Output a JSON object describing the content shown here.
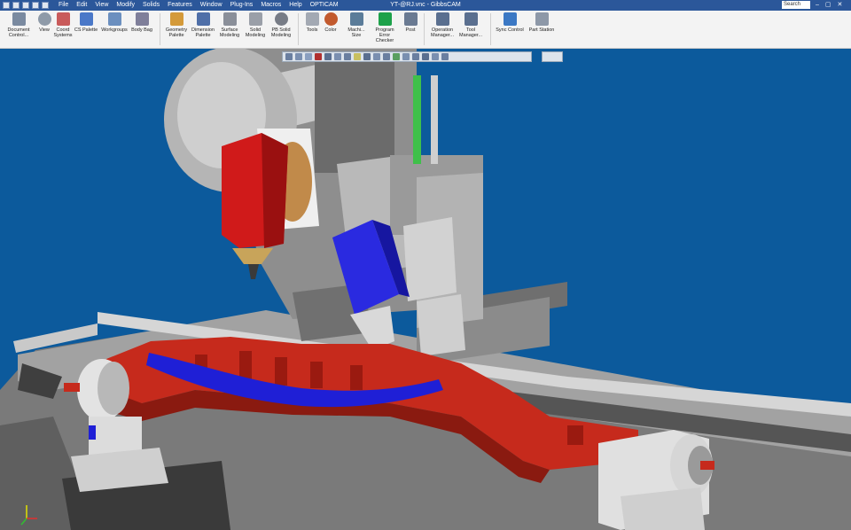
{
  "window": {
    "title": "YT-@RJ.vnc - GibbsCAM",
    "search_placeholder": "Search",
    "minimize": "–",
    "maximize": "▢",
    "close": "✕"
  },
  "menu": [
    "File",
    "Edit",
    "View",
    "Modify",
    "Solids",
    "Features",
    "Window",
    "Plug-Ins",
    "Macros",
    "Help",
    "OPTICAM"
  ],
  "ribbon": [
    {
      "l1": "Document",
      "l2": "Control...",
      "icon": "document-control-icon",
      "color": "#7a8aa0"
    },
    {
      "l1": "View",
      "l2": "",
      "icon": "view-icon",
      "color": "#8e9aa8"
    },
    {
      "l1": "Coord",
      "l2": "Systems",
      "icon": "coord-systems-icon",
      "color": "#c95b5b"
    },
    {
      "l1": "CS Palette",
      "l2": "",
      "icon": "cs-palette-icon",
      "color": "#4a78c8"
    },
    {
      "l1": "Workgroups",
      "l2": "",
      "icon": "workgroups-icon",
      "color": "#6b8fbf"
    },
    {
      "l1": "Body Bag",
      "l2": "",
      "icon": "body-bag-icon",
      "color": "#7f7f9a"
    },
    {
      "l1": "Geometry",
      "l2": "Palette",
      "icon": "geometry-palette-icon",
      "color": "#d49a3a"
    },
    {
      "l1": "Dimension",
      "l2": "Palette",
      "icon": "dimension-palette-icon",
      "color": "#4f6fa8"
    },
    {
      "l1": "Surface",
      "l2": "Modeling",
      "icon": "surface-modeling-icon",
      "color": "#8a8f99"
    },
    {
      "l1": "Solid",
      "l2": "Modeling",
      "icon": "solid-modeling-icon",
      "color": "#9a9fa8"
    },
    {
      "l1": "PB Solid",
      "l2": "Modeling",
      "icon": "pb-solid-modeling-icon",
      "color": "#777c86"
    },
    {
      "l1": "Tools",
      "l2": "",
      "icon": "tools-icon",
      "color": "#a3a9b3"
    },
    {
      "l1": "Color",
      "l2": "",
      "icon": "color-icon",
      "color": "#c25a2e"
    },
    {
      "l1": "Machi...",
      "l2": "Size",
      "icon": "machine-size-icon",
      "color": "#5b7c99"
    },
    {
      "l1": "Program",
      "l2": "Error Checker",
      "icon": "check-icon",
      "color": "#1da14a"
    },
    {
      "l1": "Post",
      "l2": "",
      "icon": "post-icon",
      "color": "#6a7a92"
    },
    {
      "l1": "Operation",
      "l2": "Manager...",
      "icon": "operation-manager-icon",
      "color": "#5a6f8f"
    },
    {
      "l1": "Tool",
      "l2": "Manager...",
      "icon": "tool-manager-icon",
      "color": "#5a6f8f"
    },
    {
      "l1": "Sync Control",
      "l2": "",
      "icon": "sync-control-icon",
      "color": "#3b78c4"
    },
    {
      "l1": "Part Station",
      "l2": "",
      "icon": "part-station-icon",
      "color": "#8d98a8"
    }
  ],
  "viewport": {
    "background": "#0c5a9c",
    "part_color": "#c62a1c",
    "toolpath_color": "#1f1fd6",
    "spindle_color": "#d01a1a",
    "tool_head_color": "#2a2ae0"
  }
}
